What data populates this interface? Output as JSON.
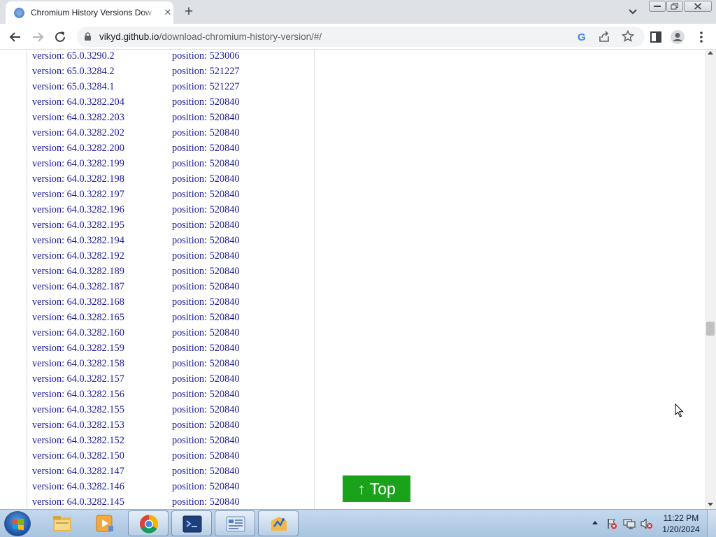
{
  "browser": {
    "tab_title": "Chromium History Versions Dow",
    "url_host": "vikyd.github.io",
    "url_path": "/download-chromium-history-version/#/"
  },
  "versions": [
    {
      "version": "version: 65.0.3290.2",
      "position": "position: 523006"
    },
    {
      "version": "version: 65.0.3284.2",
      "position": "position: 521227"
    },
    {
      "version": "version: 65.0.3284.1",
      "position": "position: 521227"
    },
    {
      "version": "version: 64.0.3282.204",
      "position": "position: 520840"
    },
    {
      "version": "version: 64.0.3282.203",
      "position": "position: 520840"
    },
    {
      "version": "version: 64.0.3282.202",
      "position": "position: 520840"
    },
    {
      "version": "version: 64.0.3282.200",
      "position": "position: 520840"
    },
    {
      "version": "version: 64.0.3282.199",
      "position": "position: 520840"
    },
    {
      "version": "version: 64.0.3282.198",
      "position": "position: 520840"
    },
    {
      "version": "version: 64.0.3282.197",
      "position": "position: 520840"
    },
    {
      "version": "version: 64.0.3282.196",
      "position": "position: 520840"
    },
    {
      "version": "version: 64.0.3282.195",
      "position": "position: 520840"
    },
    {
      "version": "version: 64.0.3282.194",
      "position": "position: 520840"
    },
    {
      "version": "version: 64.0.3282.192",
      "position": "position: 520840"
    },
    {
      "version": "version: 64.0.3282.189",
      "position": "position: 520840"
    },
    {
      "version": "version: 64.0.3282.187",
      "position": "position: 520840"
    },
    {
      "version": "version: 64.0.3282.168",
      "position": "position: 520840"
    },
    {
      "version": "version: 64.0.3282.165",
      "position": "position: 520840"
    },
    {
      "version": "version: 64.0.3282.160",
      "position": "position: 520840"
    },
    {
      "version": "version: 64.0.3282.159",
      "position": "position: 520840"
    },
    {
      "version": "version: 64.0.3282.158",
      "position": "position: 520840"
    },
    {
      "version": "version: 64.0.3282.157",
      "position": "position: 520840"
    },
    {
      "version": "version: 64.0.3282.156",
      "position": "position: 520840"
    },
    {
      "version": "version: 64.0.3282.155",
      "position": "position: 520840"
    },
    {
      "version": "version: 64.0.3282.153",
      "position": "position: 520840"
    },
    {
      "version": "version: 64.0.3282.152",
      "position": "position: 520840"
    },
    {
      "version": "version: 64.0.3282.150",
      "position": "position: 520840"
    },
    {
      "version": "version: 64.0.3282.147",
      "position": "position: 520840"
    },
    {
      "version": "version: 64.0.3282.146",
      "position": "position: 520840"
    },
    {
      "version": "version: 64.0.3282.145",
      "position": "position: 520840"
    }
  ],
  "top_button": "↑ Top",
  "taskbar": {
    "apps": [
      "file-explorer-icon",
      "media-player-icon",
      "chrome-icon",
      "terminal-icon",
      "control-panel-icon",
      "app-icon"
    ],
    "clock_time": "11:22 PM",
    "clock_date": "1/20/2024"
  },
  "colors": {
    "link": "#1a1a9c",
    "top_button": "#1aa31a",
    "tabstrip": "#dee1e6"
  }
}
